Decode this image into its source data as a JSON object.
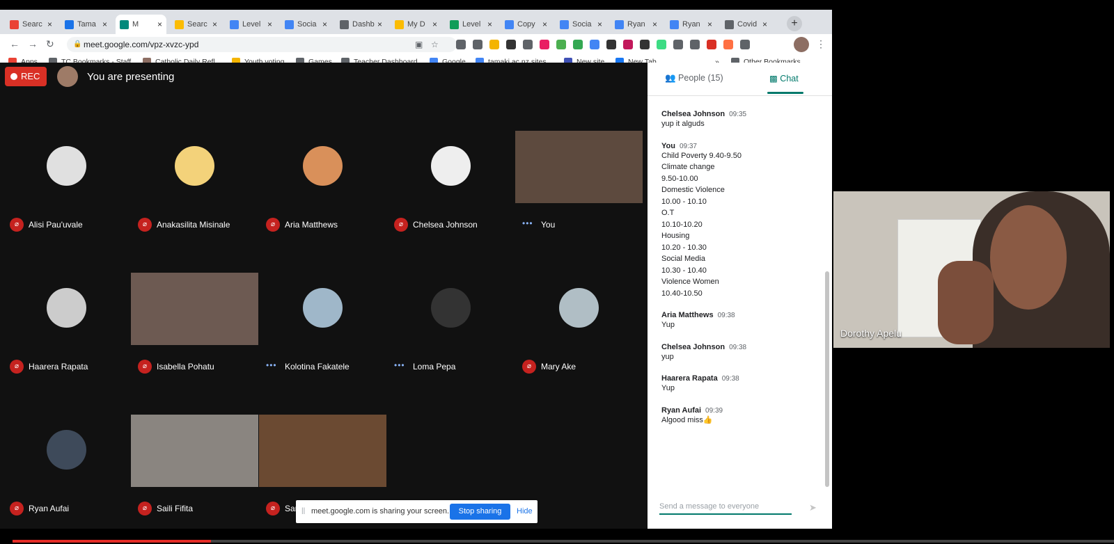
{
  "browser": {
    "tabs": [
      {
        "label": "Searc",
        "icon": "gmail-icon",
        "color": "#ea4335"
      },
      {
        "label": "Tama",
        "icon": "calendar-icon",
        "color": "#1a73e8"
      },
      {
        "label": "M",
        "icon": "meet-icon",
        "color": "#00897b"
      },
      {
        "label": "Searc",
        "icon": "drive-icon",
        "color": "#fbbc04"
      },
      {
        "label": "Level",
        "icon": "docs-icon",
        "color": "#4285f4"
      },
      {
        "label": "Socia",
        "icon": "docs-icon",
        "color": "#4285f4"
      },
      {
        "label": "Dashb",
        "icon": "dashboard-icon",
        "color": "#5f6368"
      },
      {
        "label": "My D",
        "icon": "drive-icon",
        "color": "#fbbc04"
      },
      {
        "label": "Level",
        "icon": "sheets-icon",
        "color": "#0f9d58"
      },
      {
        "label": "Copy",
        "icon": "docs-icon",
        "color": "#4285f4"
      },
      {
        "label": "Socia",
        "icon": "docs-icon",
        "color": "#4285f4"
      },
      {
        "label": "Ryan",
        "icon": "docs-icon",
        "color": "#4285f4"
      },
      {
        "label": "Ryan",
        "icon": "docs-icon",
        "color": "#4285f4"
      },
      {
        "label": "Covid",
        "icon": "page-icon",
        "color": "#5f6368"
      }
    ],
    "url": "meet.google.com/vpz-xvzc-ypd",
    "bookmarks": [
      {
        "label": "Apps",
        "icon": "apps-grid-icon",
        "color": "#ea4335"
      },
      {
        "label": "TC Bookmarks - Staff",
        "icon": "folder-icon",
        "color": "#5f6368"
      },
      {
        "label": "Catholic Daily Refl...",
        "icon": "bookmark-icon",
        "color": "#8d6e63"
      },
      {
        "label": "Youth voting",
        "icon": "bookmark-icon",
        "color": "#f4b400"
      },
      {
        "label": "Games",
        "icon": "bookmark-icon",
        "color": "#5f6368"
      },
      {
        "label": "Teacher Dashboard",
        "icon": "dashboard-icon",
        "color": "#5f6368"
      },
      {
        "label": "Google",
        "icon": "google-icon",
        "color": "#4285f4"
      },
      {
        "label": "tamaki.ac.nz sites...",
        "icon": "sites-icon",
        "color": "#4285f4"
      },
      {
        "label": "New site",
        "icon": "sites-icon",
        "color": "#3f51b5"
      },
      {
        "label": "New Tab",
        "icon": "facebook-icon",
        "color": "#1877f2"
      }
    ],
    "other_bookmarks": "Other Bookmarks",
    "overflow": "»"
  },
  "meet": {
    "rec_label": "REC",
    "presenting_text": "You are presenting",
    "participants": [
      {
        "name": "Alisi Pau'uvale",
        "status": "muted",
        "avatar_color": "#e0e0e0"
      },
      {
        "name": "Anakasilita Misinale",
        "status": "muted",
        "avatar_color": "#f3d27a"
      },
      {
        "name": "Aria Matthews",
        "status": "muted",
        "avatar_color": "#d9905a"
      },
      {
        "name": "Chelsea Johnson",
        "status": "muted",
        "avatar_color": "#eeeeee"
      },
      {
        "name": "You",
        "status": "speaking",
        "avatar_color": "#5d4a3e"
      },
      {
        "name": "Haarera Rapata",
        "status": "muted",
        "avatar_color": "#cccccc"
      },
      {
        "name": "Isabella Pohatu",
        "status": "muted",
        "avatar_color": "#6d5a52"
      },
      {
        "name": "Kolotina Fakatele",
        "status": "speaking",
        "avatar_color": "#9fb7c9"
      },
      {
        "name": "Loma Pepa",
        "status": "speaking",
        "avatar_color": "#333333"
      },
      {
        "name": "Mary Ake",
        "status": "muted",
        "avatar_color": "#b0bec5"
      },
      {
        "name": "Ryan Aufai",
        "status": "muted",
        "avatar_color": "#3e4a5a"
      },
      {
        "name": "Saili Fifita",
        "status": "muted",
        "avatar_color": "#8a8580"
      },
      {
        "name": "Sar",
        "status": "muted",
        "avatar_color": "#6b4a32"
      }
    ],
    "share_text": "meet.google.com is sharing your screen.",
    "stop_sharing": "Stop sharing",
    "hide": "Hide",
    "self_view_name": "Dorothy Apelu"
  },
  "chat": {
    "people_tab": "People (15)",
    "chat_tab": "Chat",
    "messages": [
      {
        "sender": "Chelsea Johnson",
        "time": "09:35",
        "lines": [
          "yup it alguds"
        ]
      },
      {
        "sender": "You",
        "time": "09:37",
        "lines": [
          "Child Poverty 9.40-9.50",
          "Climate change",
          "9.50-10.00",
          "Domestic Violence",
          "10.00 - 10.10",
          "O.T",
          "10.10-10.20",
          "Housing",
          "10.20 - 10.30",
          "Social Media",
          "10.30 - 10.40",
          "Violence Women",
          "10.40-10.50"
        ]
      },
      {
        "sender": "Aria Matthews",
        "time": "09:38",
        "lines": [
          "Yup"
        ]
      },
      {
        "sender": "Chelsea Johnson",
        "time": "09:38",
        "lines": [
          "yup"
        ]
      },
      {
        "sender": "Haarera Rapata",
        "time": "09:38",
        "lines": [
          "Yup"
        ]
      },
      {
        "sender": "Ryan Aufai",
        "time": "09:39",
        "lines": [
          "Algood miss👍"
        ]
      }
    ],
    "composer_placeholder": "Send a message to everyone"
  },
  "video_progress": 0.18,
  "colors": {
    "accent": "#00796b",
    "rec": "#d93025",
    "stop": "#1a73e8",
    "progress": "#e52d27"
  }
}
